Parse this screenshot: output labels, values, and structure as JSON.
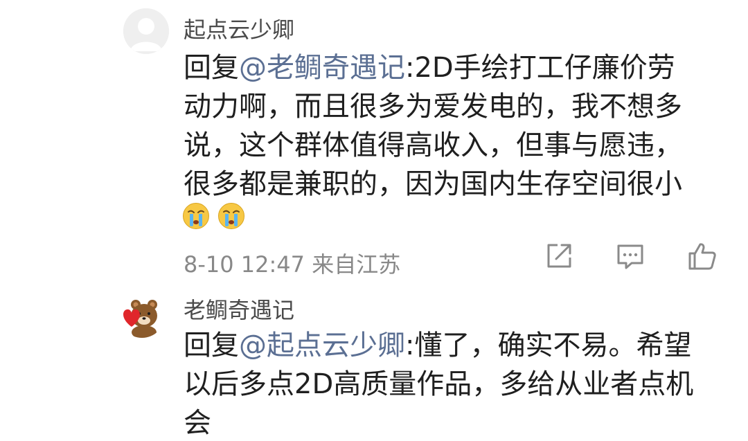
{
  "comments": [
    {
      "username": "起点云少卿",
      "reply_prefix": "回复",
      "mention": "@老鲷奇遇记",
      "lines": [
        ":2D手绘打工仔廉价劳",
        "动力啊，而且很多为爱发电的，我不想多",
        "说，这个群体值得高收入，但事与愿违，",
        "很多都是兼职的，因为国内生存空间很小"
      ],
      "emojis": [
        "crying-face",
        "crying-face"
      ],
      "time": "8-10 12:47",
      "location": "来自江苏",
      "actions": [
        "share-icon",
        "reply-icon",
        "like-icon"
      ]
    },
    {
      "username": "老鲷奇遇记",
      "reply_prefix": "回复",
      "mention": "@起点云少卿",
      "lines": [
        ":懂了，确实不易。希望",
        "以后多点2D高质量作品，多给从业者点机",
        "会"
      ]
    }
  ],
  "colors": {
    "mention": "#5b6f93",
    "meta": "#888888",
    "text": "#1f1f1f"
  }
}
